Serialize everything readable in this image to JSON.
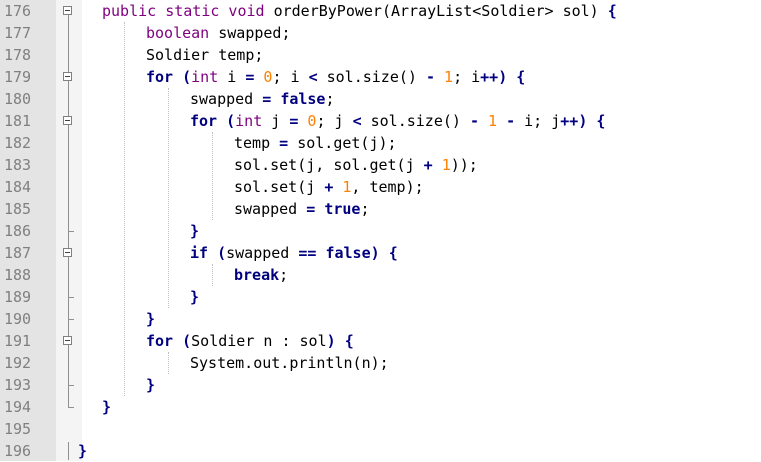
{
  "editor": {
    "first_line": 176,
    "lines": [
      {
        "n": "176",
        "indent": 1,
        "tokens": [
          {
            "t": "public static void ",
            "c": "kt"
          },
          {
            "t": "orderByPower(ArrayList<Soldier> sol) ",
            "c": ""
          },
          {
            "t": "{",
            "c": "op"
          }
        ]
      },
      {
        "n": "177",
        "indent": 2,
        "tokens": [
          {
            "t": "boolean ",
            "c": "kt"
          },
          {
            "t": "swapped;",
            "c": ""
          }
        ]
      },
      {
        "n": "178",
        "indent": 2,
        "tokens": [
          {
            "t": "Soldier temp;",
            "c": ""
          }
        ]
      },
      {
        "n": "179",
        "indent": 2,
        "tokens": [
          {
            "t": "for ",
            "c": "kw"
          },
          {
            "t": "(",
            "c": "op"
          },
          {
            "t": "int ",
            "c": "kt"
          },
          {
            "t": "i ",
            "c": ""
          },
          {
            "t": "= ",
            "c": "op"
          },
          {
            "t": "0",
            "c": "num"
          },
          {
            "t": "; i ",
            "c": ""
          },
          {
            "t": "< ",
            "c": "op"
          },
          {
            "t": "sol.size() ",
            "c": ""
          },
          {
            "t": "- ",
            "c": "op"
          },
          {
            "t": "1",
            "c": "num"
          },
          {
            "t": "; i",
            "c": ""
          },
          {
            "t": "++",
            "c": "op"
          },
          {
            "t": ") ",
            "c": "op"
          },
          {
            "t": "{",
            "c": "op"
          }
        ]
      },
      {
        "n": "180",
        "indent": 3,
        "tokens": [
          {
            "t": "swapped ",
            "c": ""
          },
          {
            "t": "= ",
            "c": "op"
          },
          {
            "t": "false",
            "c": "kw"
          },
          {
            "t": ";",
            "c": ""
          }
        ]
      },
      {
        "n": "181",
        "indent": 3,
        "tokens": [
          {
            "t": "for ",
            "c": "kw"
          },
          {
            "t": "(",
            "c": "op"
          },
          {
            "t": "int ",
            "c": "kt"
          },
          {
            "t": "j ",
            "c": ""
          },
          {
            "t": "= ",
            "c": "op"
          },
          {
            "t": "0",
            "c": "num"
          },
          {
            "t": "; j ",
            "c": ""
          },
          {
            "t": "< ",
            "c": "op"
          },
          {
            "t": "sol.size() ",
            "c": ""
          },
          {
            "t": "- ",
            "c": "op"
          },
          {
            "t": "1 ",
            "c": "num"
          },
          {
            "t": "- ",
            "c": "op"
          },
          {
            "t": "i; j",
            "c": ""
          },
          {
            "t": "++",
            "c": "op"
          },
          {
            "t": ") ",
            "c": "op"
          },
          {
            "t": "{",
            "c": "op"
          }
        ]
      },
      {
        "n": "182",
        "indent": 4,
        "tokens": [
          {
            "t": "temp ",
            "c": ""
          },
          {
            "t": "= ",
            "c": "op"
          },
          {
            "t": "sol.get(j);",
            "c": ""
          }
        ]
      },
      {
        "n": "183",
        "indent": 4,
        "tokens": [
          {
            "t": "sol.set(j, sol.get(j ",
            "c": ""
          },
          {
            "t": "+ ",
            "c": "op"
          },
          {
            "t": "1",
            "c": "num"
          },
          {
            "t": "));",
            "c": ""
          }
        ]
      },
      {
        "n": "184",
        "indent": 4,
        "tokens": [
          {
            "t": "sol.set(j ",
            "c": ""
          },
          {
            "t": "+ ",
            "c": "op"
          },
          {
            "t": "1",
            "c": "num"
          },
          {
            "t": ", temp);",
            "c": ""
          }
        ]
      },
      {
        "n": "185",
        "indent": 4,
        "tokens": [
          {
            "t": "swapped ",
            "c": ""
          },
          {
            "t": "= ",
            "c": "op"
          },
          {
            "t": "true",
            "c": "kw"
          },
          {
            "t": ";",
            "c": ""
          }
        ]
      },
      {
        "n": "186",
        "indent": 3,
        "tokens": [
          {
            "t": "}",
            "c": "op"
          }
        ]
      },
      {
        "n": "187",
        "indent": 3,
        "tokens": [
          {
            "t": "if ",
            "c": "kw"
          },
          {
            "t": "(",
            "c": "op"
          },
          {
            "t": "swapped ",
            "c": ""
          },
          {
            "t": "== ",
            "c": "op"
          },
          {
            "t": "false",
            "c": "kw"
          },
          {
            "t": ") ",
            "c": "op"
          },
          {
            "t": "{",
            "c": "op"
          }
        ]
      },
      {
        "n": "188",
        "indent": 4,
        "tokens": [
          {
            "t": "break",
            "c": "kw"
          },
          {
            "t": ";",
            "c": ""
          }
        ]
      },
      {
        "n": "189",
        "indent": 3,
        "tokens": [
          {
            "t": "}",
            "c": "op"
          }
        ]
      },
      {
        "n": "190",
        "indent": 2,
        "tokens": [
          {
            "t": "}",
            "c": "op"
          }
        ]
      },
      {
        "n": "191",
        "indent": 2,
        "tokens": [
          {
            "t": "for ",
            "c": "kw"
          },
          {
            "t": "(",
            "c": "op"
          },
          {
            "t": "Soldier n : sol",
            "c": ""
          },
          {
            "t": ") ",
            "c": "op"
          },
          {
            "t": "{",
            "c": "op"
          }
        ]
      },
      {
        "n": "192",
        "indent": 3,
        "tokens": [
          {
            "t": "System.out.println(n);",
            "c": ""
          }
        ]
      },
      {
        "n": "193",
        "indent": 2,
        "tokens": [
          {
            "t": "}",
            "c": "op"
          }
        ]
      },
      {
        "n": "194",
        "indent": 1,
        "tokens": [
          {
            "t": "}",
            "c": "op"
          }
        ]
      },
      {
        "n": "195",
        "indent": 0,
        "tokens": []
      },
      {
        "n": "196",
        "indent": 0,
        "tokens": [
          {
            "t": "}",
            "c": "op"
          }
        ]
      }
    ]
  }
}
